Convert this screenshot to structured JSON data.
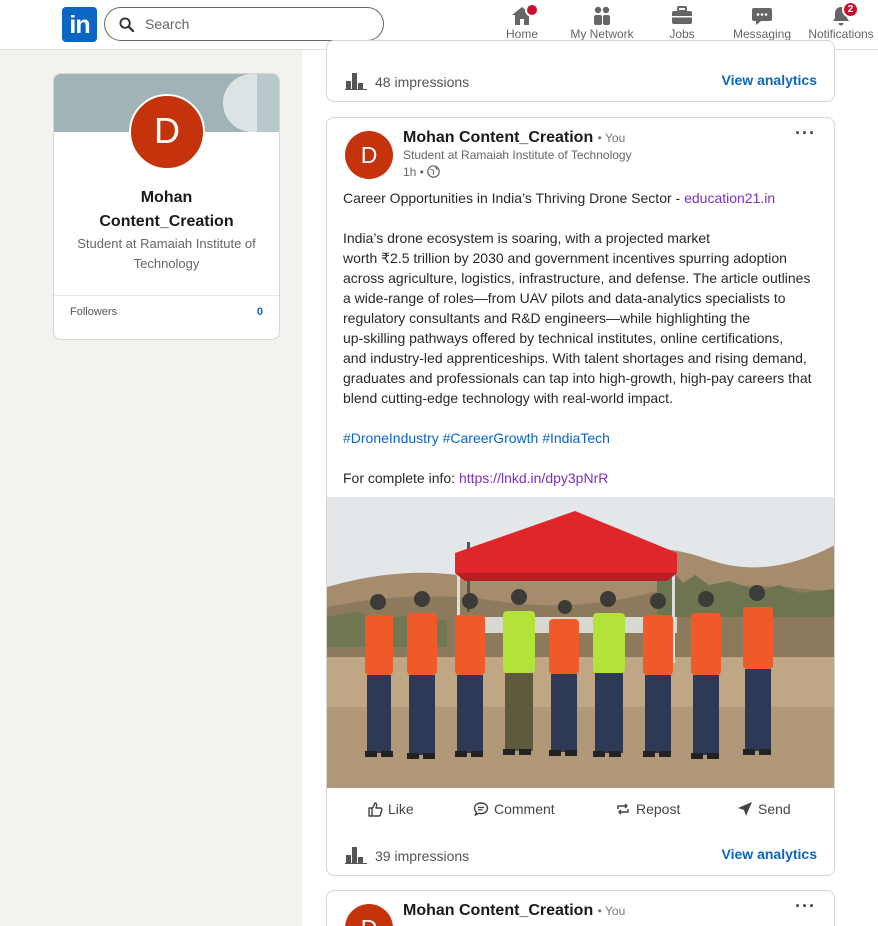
{
  "nav": {
    "logo": "in",
    "search_placeholder": "Search",
    "items": [
      {
        "label": "Home",
        "icon": "home-icon"
      },
      {
        "label": "My Network",
        "icon": "network-icon"
      },
      {
        "label": "Jobs",
        "icon": "briefcase-icon"
      },
      {
        "label": "Messaging",
        "icon": "messaging-icon"
      },
      {
        "label": "Notifications",
        "icon": "bell-icon"
      }
    ],
    "notifications_count": "2"
  },
  "profile": {
    "initial": "D",
    "name_line1": "Mohan",
    "name_line2": "Content_Creation",
    "headline": "Student at Ramaiah Institute of Technology",
    "followers_label": "Followers",
    "followers_count": "0"
  },
  "prev_post": {
    "impressions": "48 impressions",
    "view_analytics": "View analytics"
  },
  "post": {
    "initial": "D",
    "author": "Mohan Content_Creation",
    "you": "• You",
    "headline": "Student at Ramaiah Institute of Technology",
    "time": "1h •",
    "more": "···",
    "title_text": "Career Opportunities in India’s Thriving Drone Sector - ",
    "title_link": "education21.in",
    "body_lines": [
      "India’s drone ecosystem is soaring, with a projected market",
      "worth ₹2.5 trillion by 2030 and government incentives spurring adoption",
      "across agriculture, logistics, infrastructure, and defense. The article outlines",
      "a wide-range of roles—from UAV pilots and data-analytics specialists to",
      "regulatory consultants and R&D engineers—while highlighting the",
      "up-skilling pathways offered by technical institutes, online certifications,",
      "and industry-led apprenticeships. With talent shortages and rising demand,",
      "graduates and professionals can tap into high-growth, high-pay careers that",
      "blend cutting-edge technology with real-world impact."
    ],
    "hashtags": [
      "#DroneIndustry",
      "#CareerGrowth",
      "#IndiaTech"
    ],
    "info_label": "For complete info: ",
    "info_link": "https://lnkd.in/dpy3pNrR",
    "actions": [
      "Like",
      "Comment",
      "Repost",
      "Send"
    ],
    "impressions": "39 impressions",
    "view_analytics": "View analytics"
  },
  "next_post": {
    "initial": "D",
    "author": "Mohan Content_Creation",
    "you": "• You",
    "more": "···"
  }
}
